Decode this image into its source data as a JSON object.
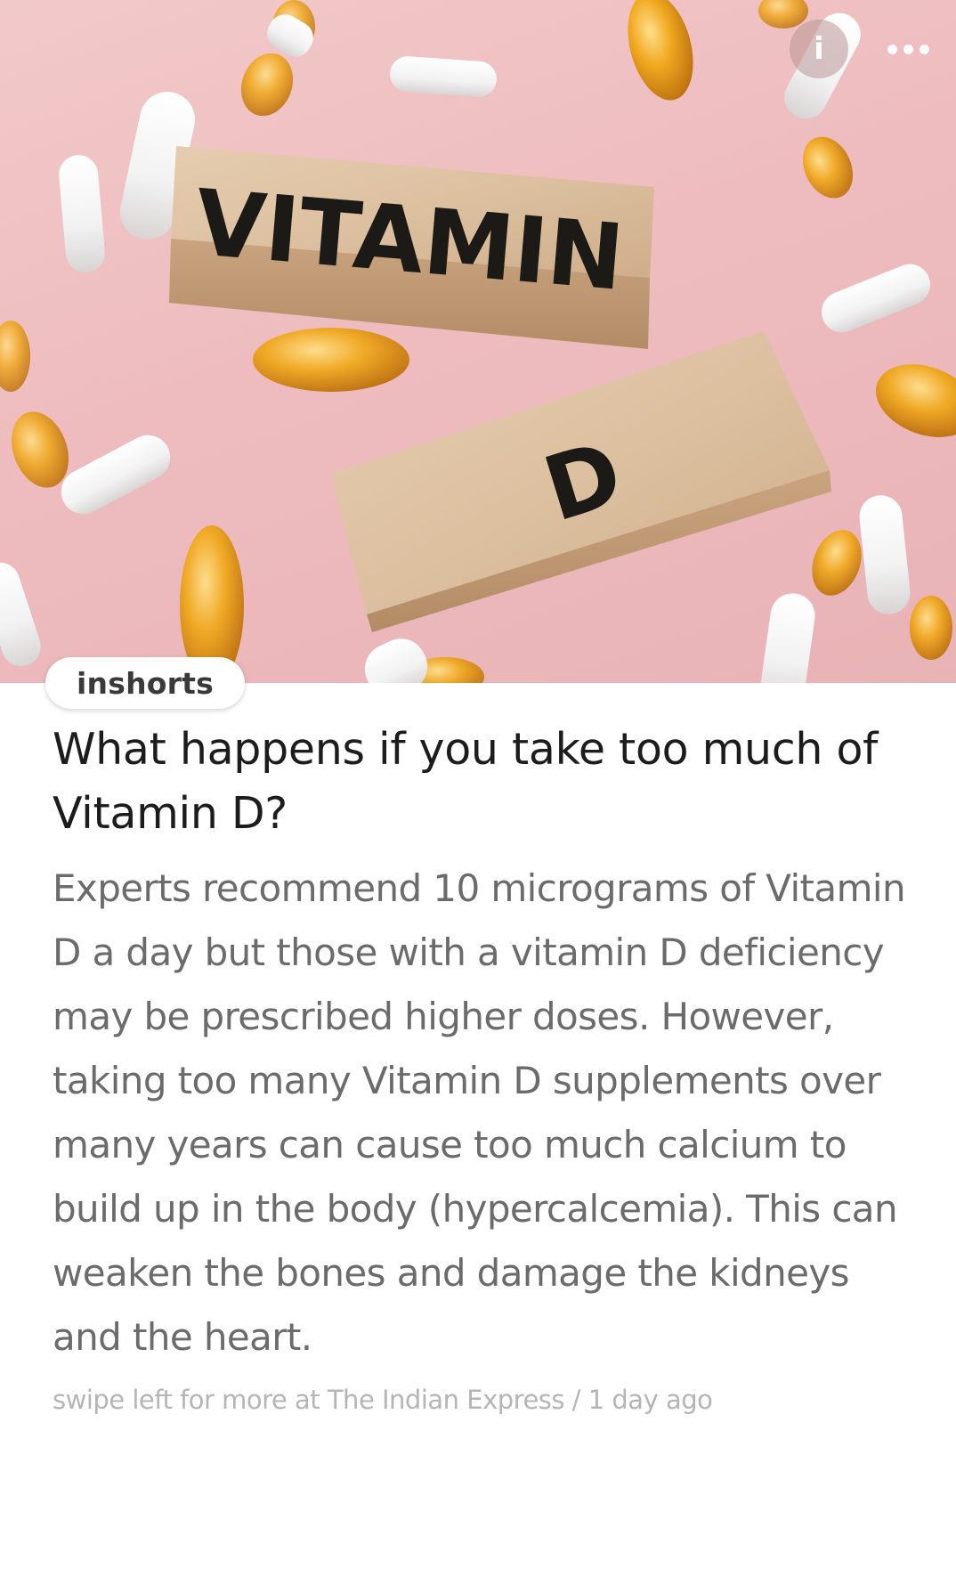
{
  "hero": {
    "image_label": "Vitamin D supplements image",
    "block_top_text": "VITAMIN",
    "block_bottom_text": "D"
  },
  "controls": {
    "info_label": "i"
  },
  "source": {
    "label": "inshorts"
  },
  "article": {
    "title": "What happens if you take too much of Vitamin D?",
    "body": "Experts recommend 10 micrograms of Vitamin D a day but those with a vitamin D deficiency may be prescribed higher doses. However, taking too many Vitamin D supplements over many years can cause too much calcium to build up in the body (hypercalcemia). This can weaken the bones and damage the kidneys and the heart.",
    "footer_prefix": "swipe left for more at ",
    "publisher": "The Indian Express",
    "separator": " / ",
    "time_ago": "1 day ago"
  }
}
